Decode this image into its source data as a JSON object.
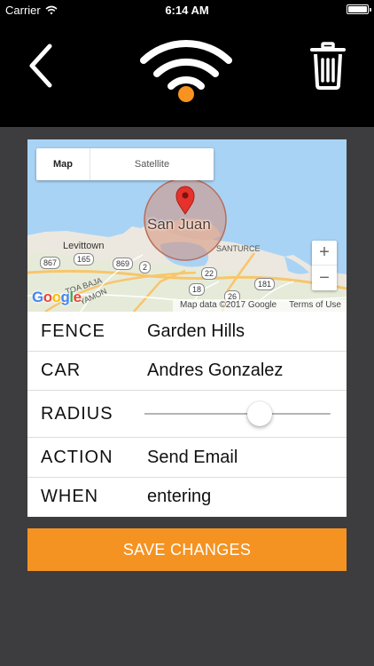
{
  "status_bar": {
    "carrier": "Carrier",
    "time": "6:14 AM",
    "battery_level": 1.0
  },
  "header": {
    "back_icon": "chevron-left-icon",
    "logo_icon": "wifi-icon",
    "delete_icon": "trash-icon",
    "accent_color": "#f7931e"
  },
  "map": {
    "type_control": {
      "map_label": "Map",
      "satellite_label": "Satellite",
      "selected": "Map"
    },
    "place_label": "San Juan",
    "labels": {
      "levittown": "Levittown",
      "santurce": "SANTURCE",
      "toa_baja": "TOA BAJA",
      "bayamon": "YAMON"
    },
    "road_shields": [
      "867",
      "165",
      "869",
      "2",
      "22",
      "18",
      "26",
      "181"
    ],
    "zoom_in": "+",
    "zoom_out": "−",
    "logo_text": "Google",
    "attribution": "Map data ©2017 Google",
    "terms": "Terms of Use"
  },
  "fields": {
    "fence": {
      "label": "FENCE",
      "value": "Garden Hills"
    },
    "car": {
      "label": "CAR",
      "value": "Andres Gonzalez"
    },
    "radius": {
      "label": "RADIUS",
      "level": 0.62
    },
    "action": {
      "label": "ACTION",
      "value": "Send Email"
    },
    "when": {
      "label": "WHEN",
      "value": "entering"
    }
  },
  "save_button": {
    "label": "SAVE CHANGES",
    "color": "#f59322"
  }
}
